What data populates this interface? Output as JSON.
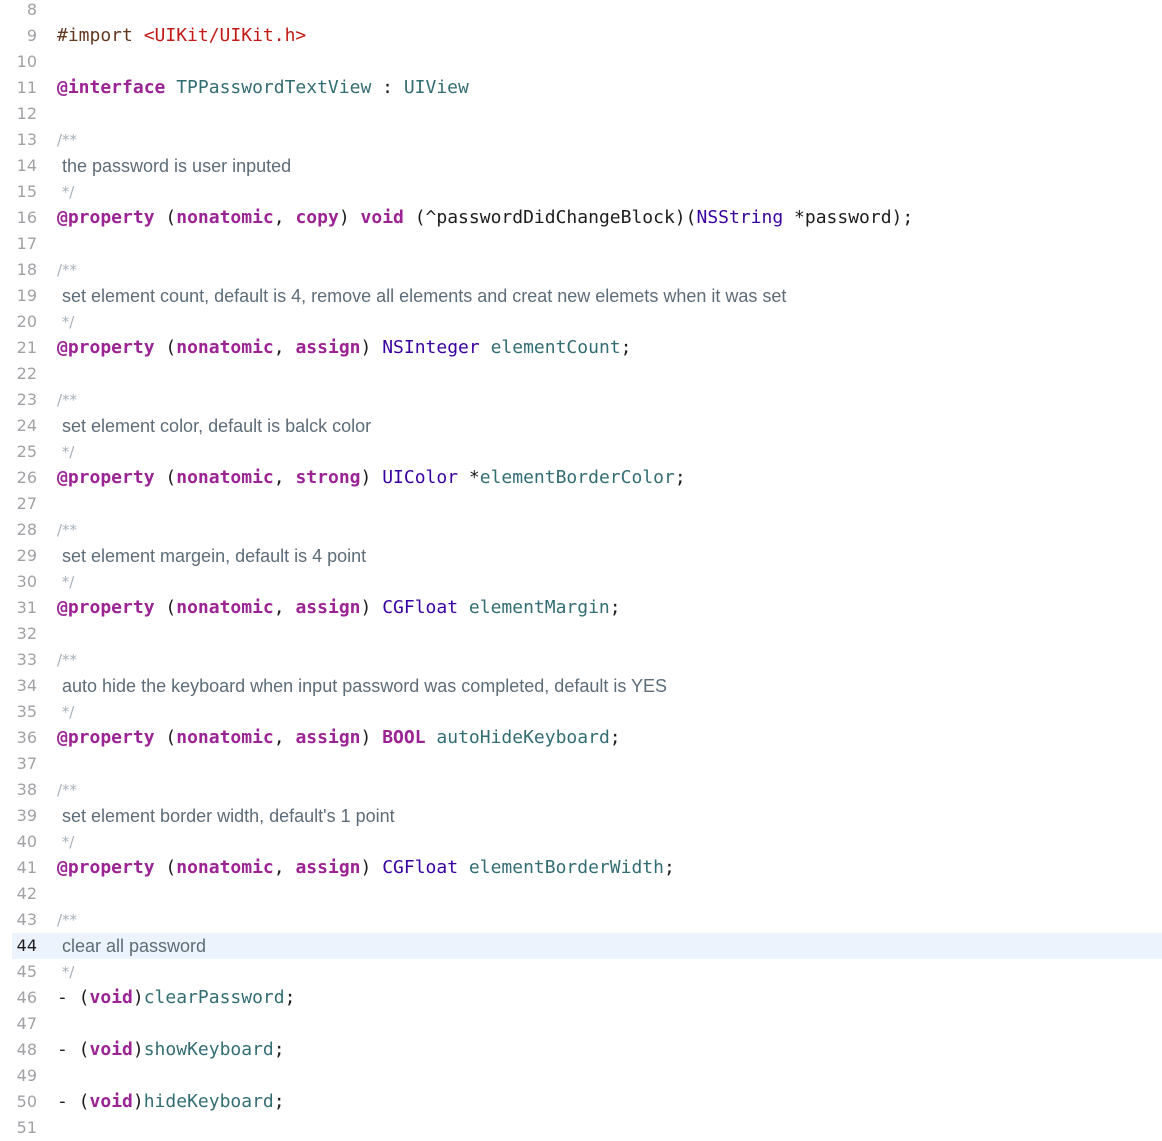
{
  "editor": {
    "lines": [
      {
        "number": "8",
        "tokens": []
      },
      {
        "number": "9",
        "tokens": [
          {
            "t": "#import ",
            "c": "preproc"
          },
          {
            "t": "<UIKit/UIKit.h>",
            "c": "string"
          }
        ]
      },
      {
        "number": "10",
        "tokens": []
      },
      {
        "number": "11",
        "tokens": [
          {
            "t": "@interface",
            "c": "keyword"
          },
          {
            "t": " ",
            "c": "punct"
          },
          {
            "t": "TPPasswordTextView",
            "c": "ident"
          },
          {
            "t": " : ",
            "c": "punct"
          },
          {
            "t": "UIView",
            "c": "ident"
          }
        ]
      },
      {
        "number": "12",
        "tokens": []
      },
      {
        "number": "13",
        "tokens": [
          {
            "t": "/**",
            "c": "doc markup"
          }
        ]
      },
      {
        "number": "14",
        "tokens": [
          {
            "t": " the password is user inputed",
            "c": "doc"
          }
        ]
      },
      {
        "number": "15",
        "tokens": [
          {
            "t": " */",
            "c": "doc markup"
          }
        ]
      },
      {
        "number": "16",
        "tokens": [
          {
            "t": "@property",
            "c": "keyword"
          },
          {
            "t": " (",
            "c": "punct"
          },
          {
            "t": "nonatomic",
            "c": "keyword"
          },
          {
            "t": ", ",
            "c": "punct"
          },
          {
            "t": "copy",
            "c": "keyword"
          },
          {
            "t": ") ",
            "c": "punct"
          },
          {
            "t": "void",
            "c": "keyword"
          },
          {
            "t": " (^passwordDidChangeBlock)(",
            "c": "punct"
          },
          {
            "t": "NSString",
            "c": "type"
          },
          {
            "t": " *password);",
            "c": "punct"
          }
        ]
      },
      {
        "number": "17",
        "tokens": []
      },
      {
        "number": "18",
        "tokens": [
          {
            "t": "/**",
            "c": "doc markup"
          }
        ]
      },
      {
        "number": "19",
        "tokens": [
          {
            "t": " set element count, default is 4, remove all elements and creat new elemets when it was set",
            "c": "doc"
          }
        ]
      },
      {
        "number": "20",
        "tokens": [
          {
            "t": " */",
            "c": "doc markup"
          }
        ]
      },
      {
        "number": "21",
        "tokens": [
          {
            "t": "@property",
            "c": "keyword"
          },
          {
            "t": " (",
            "c": "punct"
          },
          {
            "t": "nonatomic",
            "c": "keyword"
          },
          {
            "t": ", ",
            "c": "punct"
          },
          {
            "t": "assign",
            "c": "keyword"
          },
          {
            "t": ") ",
            "c": "punct"
          },
          {
            "t": "NSInteger",
            "c": "type"
          },
          {
            "t": " ",
            "c": "punct"
          },
          {
            "t": "elementCount",
            "c": "method"
          },
          {
            "t": ";",
            "c": "punct"
          }
        ]
      },
      {
        "number": "22",
        "tokens": []
      },
      {
        "number": "23",
        "tokens": [
          {
            "t": "/**",
            "c": "doc markup"
          }
        ]
      },
      {
        "number": "24",
        "tokens": [
          {
            "t": " set element color, default is balck color",
            "c": "doc"
          }
        ]
      },
      {
        "number": "25",
        "tokens": [
          {
            "t": " */",
            "c": "doc markup"
          }
        ]
      },
      {
        "number": "26",
        "tokens": [
          {
            "t": "@property",
            "c": "keyword"
          },
          {
            "t": " (",
            "c": "punct"
          },
          {
            "t": "nonatomic",
            "c": "keyword"
          },
          {
            "t": ", ",
            "c": "punct"
          },
          {
            "t": "strong",
            "c": "keyword"
          },
          {
            "t": ") ",
            "c": "punct"
          },
          {
            "t": "UIColor",
            "c": "type"
          },
          {
            "t": " *",
            "c": "punct"
          },
          {
            "t": "elementBorderColor",
            "c": "method"
          },
          {
            "t": ";",
            "c": "punct"
          }
        ]
      },
      {
        "number": "27",
        "tokens": []
      },
      {
        "number": "28",
        "tokens": [
          {
            "t": "/**",
            "c": "doc markup"
          }
        ]
      },
      {
        "number": "29",
        "tokens": [
          {
            "t": " set element margein, default is 4 point",
            "c": "doc"
          }
        ]
      },
      {
        "number": "30",
        "tokens": [
          {
            "t": " */",
            "c": "doc markup"
          }
        ]
      },
      {
        "number": "31",
        "tokens": [
          {
            "t": "@property",
            "c": "keyword"
          },
          {
            "t": " (",
            "c": "punct"
          },
          {
            "t": "nonatomic",
            "c": "keyword"
          },
          {
            "t": ", ",
            "c": "punct"
          },
          {
            "t": "assign",
            "c": "keyword"
          },
          {
            "t": ") ",
            "c": "punct"
          },
          {
            "t": "CGFloat",
            "c": "type"
          },
          {
            "t": " ",
            "c": "punct"
          },
          {
            "t": "elementMargin",
            "c": "method"
          },
          {
            "t": ";",
            "c": "punct"
          }
        ]
      },
      {
        "number": "32",
        "tokens": []
      },
      {
        "number": "33",
        "tokens": [
          {
            "t": "/**",
            "c": "doc markup"
          }
        ]
      },
      {
        "number": "34",
        "tokens": [
          {
            "t": " auto hide the keyboard when input password was completed, default is YES",
            "c": "doc"
          }
        ]
      },
      {
        "number": "35",
        "tokens": [
          {
            "t": " */",
            "c": "doc markup"
          }
        ]
      },
      {
        "number": "36",
        "tokens": [
          {
            "t": "@property",
            "c": "keyword"
          },
          {
            "t": " (",
            "c": "punct"
          },
          {
            "t": "nonatomic",
            "c": "keyword"
          },
          {
            "t": ", ",
            "c": "punct"
          },
          {
            "t": "assign",
            "c": "keyword"
          },
          {
            "t": ") ",
            "c": "punct"
          },
          {
            "t": "BOOL",
            "c": "keyword"
          },
          {
            "t": " ",
            "c": "punct"
          },
          {
            "t": "autoHideKeyboard",
            "c": "method"
          },
          {
            "t": ";",
            "c": "punct"
          }
        ]
      },
      {
        "number": "37",
        "tokens": []
      },
      {
        "number": "38",
        "tokens": [
          {
            "t": "/**",
            "c": "doc markup"
          }
        ]
      },
      {
        "number": "39",
        "tokens": [
          {
            "t": " set element border width, default's 1 point",
            "c": "doc"
          }
        ]
      },
      {
        "number": "40",
        "tokens": [
          {
            "t": " */",
            "c": "doc markup"
          }
        ]
      },
      {
        "number": "41",
        "tokens": [
          {
            "t": "@property",
            "c": "keyword"
          },
          {
            "t": " (",
            "c": "punct"
          },
          {
            "t": "nonatomic",
            "c": "keyword"
          },
          {
            "t": ", ",
            "c": "punct"
          },
          {
            "t": "assign",
            "c": "keyword"
          },
          {
            "t": ") ",
            "c": "punct"
          },
          {
            "t": "CGFloat",
            "c": "type"
          },
          {
            "t": " ",
            "c": "punct"
          },
          {
            "t": "elementBorderWidth",
            "c": "method"
          },
          {
            "t": ";",
            "c": "punct"
          }
        ]
      },
      {
        "number": "42",
        "tokens": []
      },
      {
        "number": "43",
        "tokens": [
          {
            "t": "/**",
            "c": "doc markup"
          }
        ]
      },
      {
        "number": "44",
        "current": true,
        "tokens": [
          {
            "t": " clear all password",
            "c": "doc"
          }
        ]
      },
      {
        "number": "45",
        "tokens": [
          {
            "t": " */",
            "c": "doc markup"
          }
        ]
      },
      {
        "number": "46",
        "tokens": [
          {
            "t": "- (",
            "c": "punct"
          },
          {
            "t": "void",
            "c": "keyword"
          },
          {
            "t": ")",
            "c": "punct"
          },
          {
            "t": "clearPassword",
            "c": "method"
          },
          {
            "t": ";",
            "c": "punct"
          }
        ]
      },
      {
        "number": "47",
        "tokens": []
      },
      {
        "number": "48",
        "tokens": [
          {
            "t": "- (",
            "c": "punct"
          },
          {
            "t": "void",
            "c": "keyword"
          },
          {
            "t": ")",
            "c": "punct"
          },
          {
            "t": "showKeyboard",
            "c": "method"
          },
          {
            "t": ";",
            "c": "punct"
          }
        ]
      },
      {
        "number": "49",
        "tokens": []
      },
      {
        "number": "50",
        "tokens": [
          {
            "t": "- (",
            "c": "punct"
          },
          {
            "t": "void",
            "c": "keyword"
          },
          {
            "t": ")",
            "c": "punct"
          },
          {
            "t": "hideKeyboard",
            "c": "method"
          },
          {
            "t": ";",
            "c": "punct"
          }
        ]
      },
      {
        "number": "51",
        "tokens": []
      }
    ]
  }
}
